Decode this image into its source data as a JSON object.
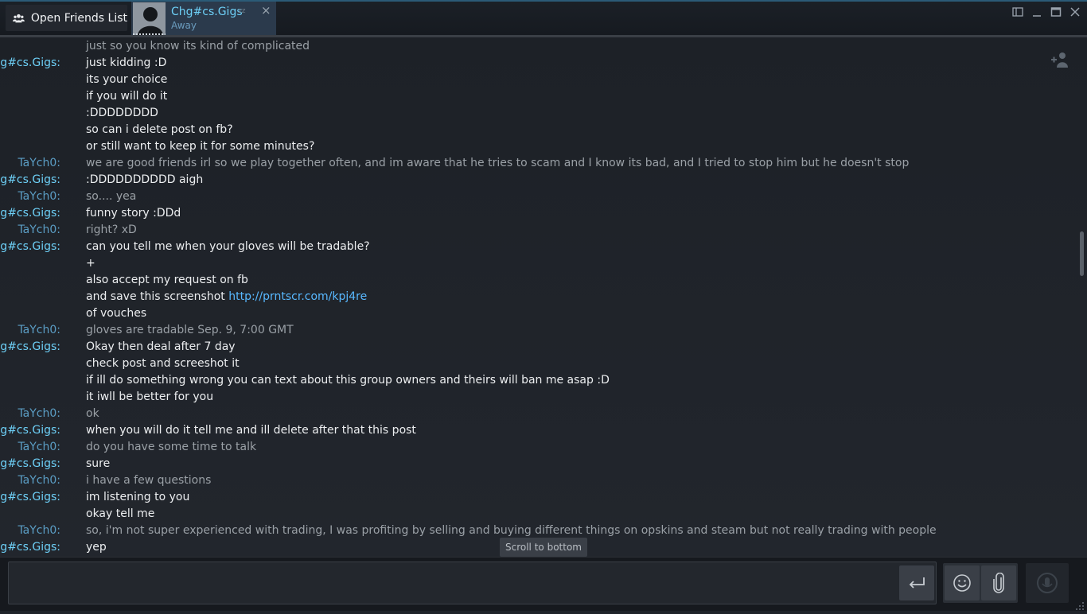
{
  "topbar": {
    "friends_button_label": "Open Friends List",
    "friends_icon": "friends-icon",
    "chat_tab": {
      "name": "Chg#cs.Gigs",
      "status": "Away",
      "status_indicator": "zz",
      "close_glyph": "×"
    },
    "window_controls": [
      "restore-layout-icon",
      "minimize-icon",
      "maximize-icon",
      "close-icon"
    ]
  },
  "chat": {
    "messages": [
      {
        "sender": "",
        "text": "just so you know its kind of complicated",
        "who": "me"
      },
      {
        "sender": "Chg#cs.Gigs:",
        "text": "just kidding :D",
        "who": "them"
      },
      {
        "sender": "",
        "text": "its your choice",
        "who": "them"
      },
      {
        "sender": "",
        "text": "if you will do it",
        "who": "them"
      },
      {
        "sender": "",
        "text": ":DDDDDDDD",
        "who": "them"
      },
      {
        "sender": "",
        "text": "so can i delete post on fb?",
        "who": "them"
      },
      {
        "sender": "",
        "text": "or still want to keep it for some minutes?",
        "who": "them"
      },
      {
        "sender": "TaYch0:",
        "text": "we are good friends irl so we play together often, and im aware that he tries to scam and I know its bad, and I tried to stop him but he doesn't stop",
        "who": "me"
      },
      {
        "sender": "Chg#cs.Gigs:",
        "text": ":DDDDDDDDDD aigh",
        "who": "them"
      },
      {
        "sender": "TaYch0:",
        "text": "so.... yea",
        "who": "me"
      },
      {
        "sender": "Chg#cs.Gigs:",
        "text": "funny story :DDd",
        "who": "them"
      },
      {
        "sender": "TaYch0:",
        "text": "right? xD",
        "who": "me"
      },
      {
        "sender": "Chg#cs.Gigs:",
        "text": "can you tell me when your gloves will be tradable?",
        "who": "them"
      },
      {
        "sender": "",
        "text": "+",
        "who": "them"
      },
      {
        "sender": "",
        "text": "also accept my request on fb",
        "who": "them"
      },
      {
        "sender": "",
        "text": "and save this screenshot ",
        "link": "http://prntscr.com/kpj4re",
        "who": "them"
      },
      {
        "sender": "",
        "text": "of vouches",
        "who": "them"
      },
      {
        "sender": "TaYch0:",
        "text": "gloves are tradable Sep. 9, 7:00 GMT",
        "who": "me"
      },
      {
        "sender": "Chg#cs.Gigs:",
        "text": "Okay then deal after 7 day",
        "who": "them"
      },
      {
        "sender": "",
        "text": "check post and screeshot it",
        "who": "them"
      },
      {
        "sender": "",
        "text": "if ill do something wrong you can text about this group owners and theirs will ban me asap :D",
        "who": "them"
      },
      {
        "sender": "",
        "text": "it iwll be better for you",
        "who": "them"
      },
      {
        "sender": "TaYch0:",
        "text": "ok",
        "who": "me"
      },
      {
        "sender": "Chg#cs.Gigs:",
        "text": "when you will do it tell me and ill delete after that this post",
        "who": "them"
      },
      {
        "sender": "TaYch0:",
        "text": "do you have some time to talk",
        "who": "me"
      },
      {
        "sender": "Chg#cs.Gigs:",
        "text": "sure",
        "who": "them"
      },
      {
        "sender": "TaYch0:",
        "text": "i have a few questions",
        "who": "me"
      },
      {
        "sender": "Chg#cs.Gigs:",
        "text": "im listening to you",
        "who": "them"
      },
      {
        "sender": "",
        "text": "okay tell me",
        "who": "them"
      },
      {
        "sender": "TaYch0:",
        "text": "so, i'm not super experienced with trading, I was profiting by selling and buying different things on opskins and steam but not really trading with people",
        "who": "me"
      },
      {
        "sender": "Chg#cs.Gigs:",
        "text": "yep",
        "who": "them"
      }
    ],
    "scroll_to_bottom_label": "Scroll to bottom",
    "add_friend_icon": "add-friend-icon"
  },
  "input": {
    "value": "",
    "placeholder": "",
    "send_icon": "enter-icon",
    "emoji_icon": "emoji-icon",
    "attach_icon": "paperclip-icon",
    "voice_icon": "voice-chat-icon"
  },
  "colors": {
    "friend_name": "#6dcff6",
    "self_name": "#5b9ec5",
    "link": "#58b8ff",
    "background": "#1f2329"
  }
}
